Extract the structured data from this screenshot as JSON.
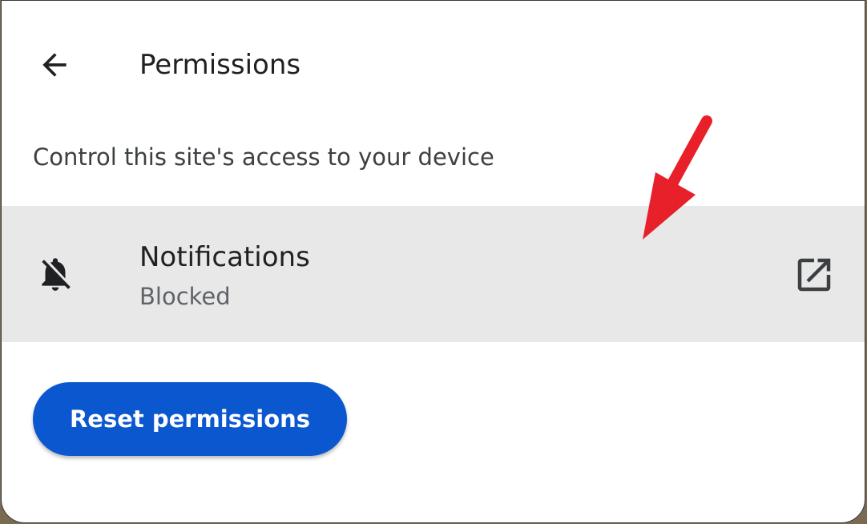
{
  "header": {
    "back_icon": "arrow-back-icon",
    "title": "Permissions"
  },
  "description": "Control this site's access to your device",
  "permissions": [
    {
      "icon": "notifications-off-icon",
      "label": "Notifications",
      "status": "Blocked",
      "action_icon": "open-in-new-icon"
    }
  ],
  "reset_button": {
    "label": "Reset permissions"
  },
  "colors": {
    "accent": "#0b57d0",
    "row_highlight": "#e8e8e8",
    "annotation": "#e8202a",
    "text_primary": "#202124",
    "text_secondary": "#5f6368"
  }
}
